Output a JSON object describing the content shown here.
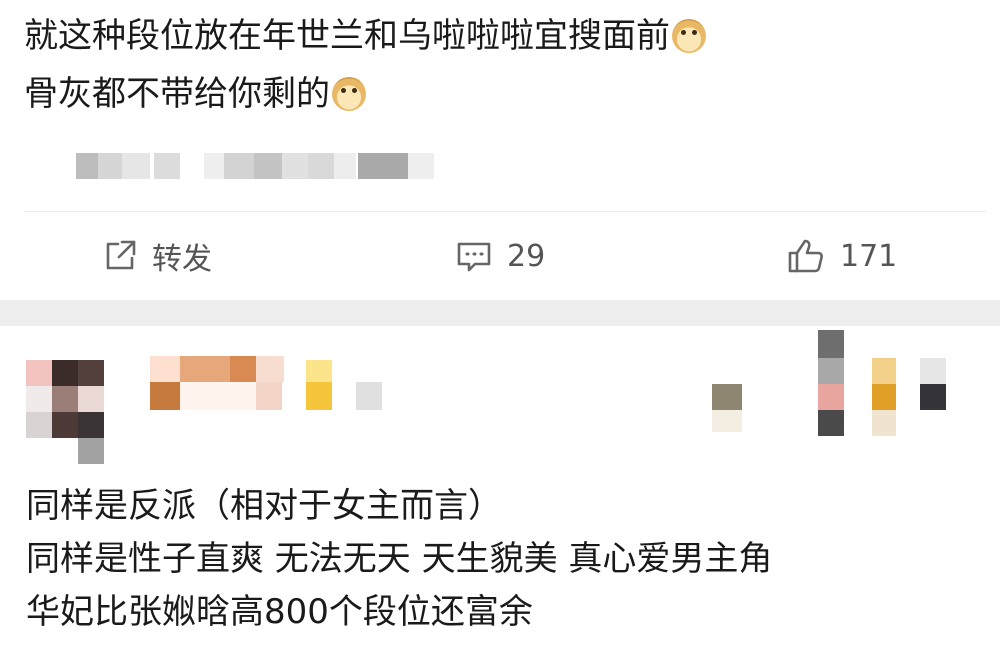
{
  "post": {
    "lines": [
      "就这种段位放在年世兰和乌啦啦啦宜搜面前",
      "骨灰都不带给你剩的"
    ],
    "emoji": "doge"
  },
  "actions": {
    "repost_label": "转发",
    "comment_count": "29",
    "like_count": "171"
  },
  "icons": {
    "repost": "repost-icon",
    "comment": "comment-icon",
    "like": "like-icon"
  },
  "comment": {
    "lines": [
      "同样是反派（相对于女主而言）",
      "同样是性子直爽 无法无天 天生貌美 真心爱男主角",
      "华妃比张娰晗高800个段位还富余"
    ]
  }
}
